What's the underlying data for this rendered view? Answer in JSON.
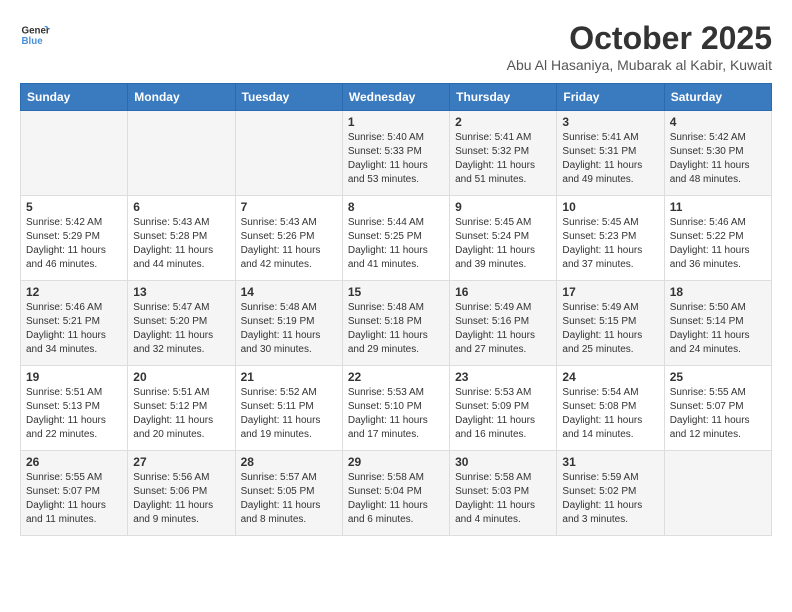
{
  "header": {
    "logo_line1": "General",
    "logo_line2": "Blue",
    "month": "October 2025",
    "location": "Abu Al Hasaniya, Mubarak al Kabir, Kuwait"
  },
  "days_of_week": [
    "Sunday",
    "Monday",
    "Tuesday",
    "Wednesday",
    "Thursday",
    "Friday",
    "Saturday"
  ],
  "weeks": [
    [
      {
        "day": "",
        "info": ""
      },
      {
        "day": "",
        "info": ""
      },
      {
        "day": "",
        "info": ""
      },
      {
        "day": "1",
        "info": "Sunrise: 5:40 AM\nSunset: 5:33 PM\nDaylight: 11 hours\nand 53 minutes."
      },
      {
        "day": "2",
        "info": "Sunrise: 5:41 AM\nSunset: 5:32 PM\nDaylight: 11 hours\nand 51 minutes."
      },
      {
        "day": "3",
        "info": "Sunrise: 5:41 AM\nSunset: 5:31 PM\nDaylight: 11 hours\nand 49 minutes."
      },
      {
        "day": "4",
        "info": "Sunrise: 5:42 AM\nSunset: 5:30 PM\nDaylight: 11 hours\nand 48 minutes."
      }
    ],
    [
      {
        "day": "5",
        "info": "Sunrise: 5:42 AM\nSunset: 5:29 PM\nDaylight: 11 hours\nand 46 minutes."
      },
      {
        "day": "6",
        "info": "Sunrise: 5:43 AM\nSunset: 5:28 PM\nDaylight: 11 hours\nand 44 minutes."
      },
      {
        "day": "7",
        "info": "Sunrise: 5:43 AM\nSunset: 5:26 PM\nDaylight: 11 hours\nand 42 minutes."
      },
      {
        "day": "8",
        "info": "Sunrise: 5:44 AM\nSunset: 5:25 PM\nDaylight: 11 hours\nand 41 minutes."
      },
      {
        "day": "9",
        "info": "Sunrise: 5:45 AM\nSunset: 5:24 PM\nDaylight: 11 hours\nand 39 minutes."
      },
      {
        "day": "10",
        "info": "Sunrise: 5:45 AM\nSunset: 5:23 PM\nDaylight: 11 hours\nand 37 minutes."
      },
      {
        "day": "11",
        "info": "Sunrise: 5:46 AM\nSunset: 5:22 PM\nDaylight: 11 hours\nand 36 minutes."
      }
    ],
    [
      {
        "day": "12",
        "info": "Sunrise: 5:46 AM\nSunset: 5:21 PM\nDaylight: 11 hours\nand 34 minutes."
      },
      {
        "day": "13",
        "info": "Sunrise: 5:47 AM\nSunset: 5:20 PM\nDaylight: 11 hours\nand 32 minutes."
      },
      {
        "day": "14",
        "info": "Sunrise: 5:48 AM\nSunset: 5:19 PM\nDaylight: 11 hours\nand 30 minutes."
      },
      {
        "day": "15",
        "info": "Sunrise: 5:48 AM\nSunset: 5:18 PM\nDaylight: 11 hours\nand 29 minutes."
      },
      {
        "day": "16",
        "info": "Sunrise: 5:49 AM\nSunset: 5:16 PM\nDaylight: 11 hours\nand 27 minutes."
      },
      {
        "day": "17",
        "info": "Sunrise: 5:49 AM\nSunset: 5:15 PM\nDaylight: 11 hours\nand 25 minutes."
      },
      {
        "day": "18",
        "info": "Sunrise: 5:50 AM\nSunset: 5:14 PM\nDaylight: 11 hours\nand 24 minutes."
      }
    ],
    [
      {
        "day": "19",
        "info": "Sunrise: 5:51 AM\nSunset: 5:13 PM\nDaylight: 11 hours\nand 22 minutes."
      },
      {
        "day": "20",
        "info": "Sunrise: 5:51 AM\nSunset: 5:12 PM\nDaylight: 11 hours\nand 20 minutes."
      },
      {
        "day": "21",
        "info": "Sunrise: 5:52 AM\nSunset: 5:11 PM\nDaylight: 11 hours\nand 19 minutes."
      },
      {
        "day": "22",
        "info": "Sunrise: 5:53 AM\nSunset: 5:10 PM\nDaylight: 11 hours\nand 17 minutes."
      },
      {
        "day": "23",
        "info": "Sunrise: 5:53 AM\nSunset: 5:09 PM\nDaylight: 11 hours\nand 16 minutes."
      },
      {
        "day": "24",
        "info": "Sunrise: 5:54 AM\nSunset: 5:08 PM\nDaylight: 11 hours\nand 14 minutes."
      },
      {
        "day": "25",
        "info": "Sunrise: 5:55 AM\nSunset: 5:07 PM\nDaylight: 11 hours\nand 12 minutes."
      }
    ],
    [
      {
        "day": "26",
        "info": "Sunrise: 5:55 AM\nSunset: 5:07 PM\nDaylight: 11 hours\nand 11 minutes."
      },
      {
        "day": "27",
        "info": "Sunrise: 5:56 AM\nSunset: 5:06 PM\nDaylight: 11 hours\nand 9 minutes."
      },
      {
        "day": "28",
        "info": "Sunrise: 5:57 AM\nSunset: 5:05 PM\nDaylight: 11 hours\nand 8 minutes."
      },
      {
        "day": "29",
        "info": "Sunrise: 5:58 AM\nSunset: 5:04 PM\nDaylight: 11 hours\nand 6 minutes."
      },
      {
        "day": "30",
        "info": "Sunrise: 5:58 AM\nSunset: 5:03 PM\nDaylight: 11 hours\nand 4 minutes."
      },
      {
        "day": "31",
        "info": "Sunrise: 5:59 AM\nSunset: 5:02 PM\nDaylight: 11 hours\nand 3 minutes."
      },
      {
        "day": "",
        "info": ""
      }
    ]
  ]
}
